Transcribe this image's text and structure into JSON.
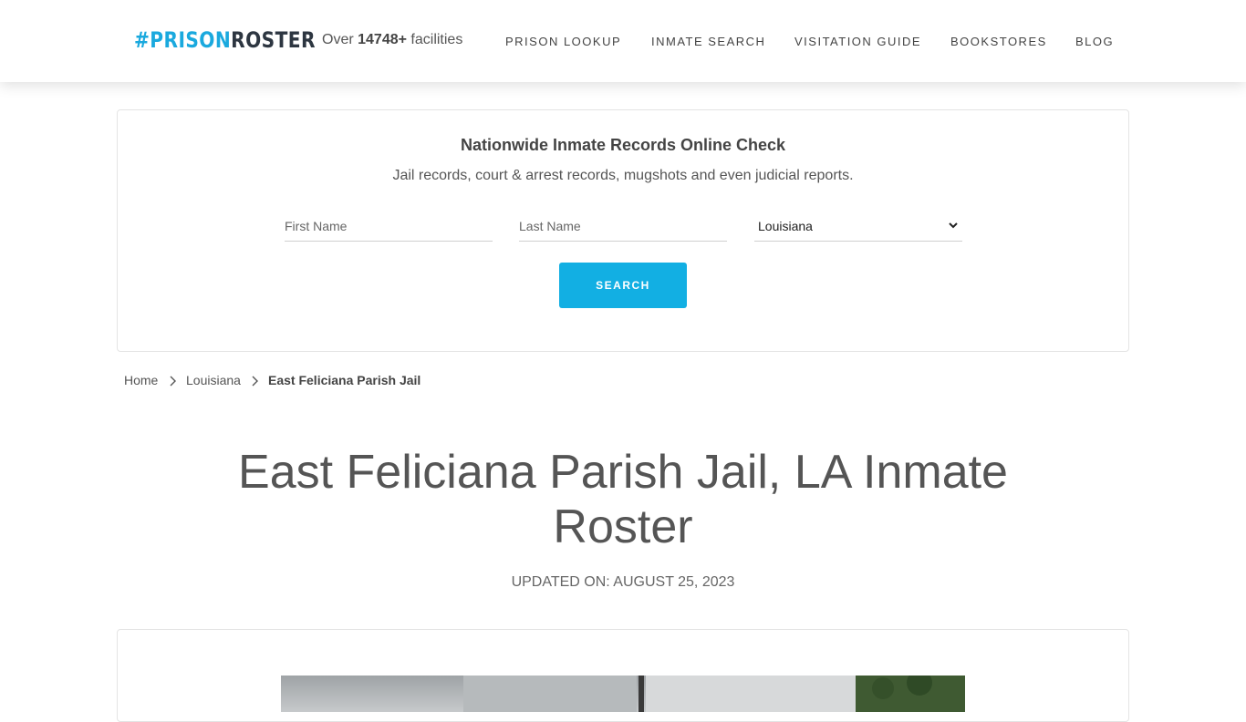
{
  "brand": {
    "hash": "#",
    "prison": "PRISON",
    "roster": "ROSTER"
  },
  "header": {
    "facilities_prefix": "Over",
    "facilities_count": "14748+",
    "facilities_suffix": "facilities",
    "nav": [
      "PRISON LOOKUP",
      "INMATE SEARCH",
      "VISITATION GUIDE",
      "BOOKSTORES",
      "BLOG"
    ]
  },
  "search": {
    "title": "Nationwide Inmate Records Online Check",
    "subtitle": "Jail records, court & arrest records, mugshots and even judicial reports.",
    "first_name_placeholder": "First Name",
    "last_name_placeholder": "Last Name",
    "state_value": "Louisiana",
    "button_label": "SEARCH"
  },
  "breadcrumb": {
    "home": "Home",
    "state": "Louisiana",
    "current": "East Feliciana Parish Jail"
  },
  "page": {
    "title": "East Feliciana Parish Jail, LA Inmate Roster",
    "updated": "UPDATED ON: AUGUST 25, 2023"
  },
  "colors": {
    "brand_blue": "#1aa9de",
    "brand_dark": "#2d3641",
    "button": "#12afe3"
  },
  "icons": [
    "chevron-down-icon",
    "chevron-right-icon"
  ]
}
